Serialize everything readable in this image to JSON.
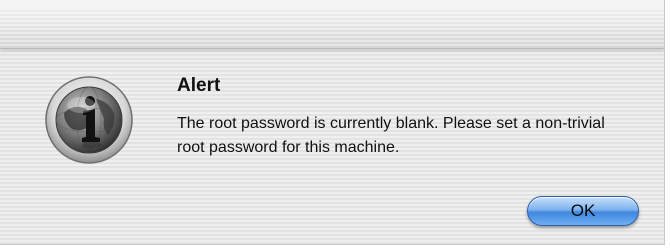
{
  "dialog": {
    "title": "Alert",
    "message": "The root password is currently blank.  Please set a non-trivial root password for this machine.",
    "ok_label": "OK",
    "icon": "info-globe-icon"
  },
  "colors": {
    "button_blue": "#3f86de",
    "stripe_light": "#efefef",
    "stripe_dark": "#e3e3e3"
  }
}
